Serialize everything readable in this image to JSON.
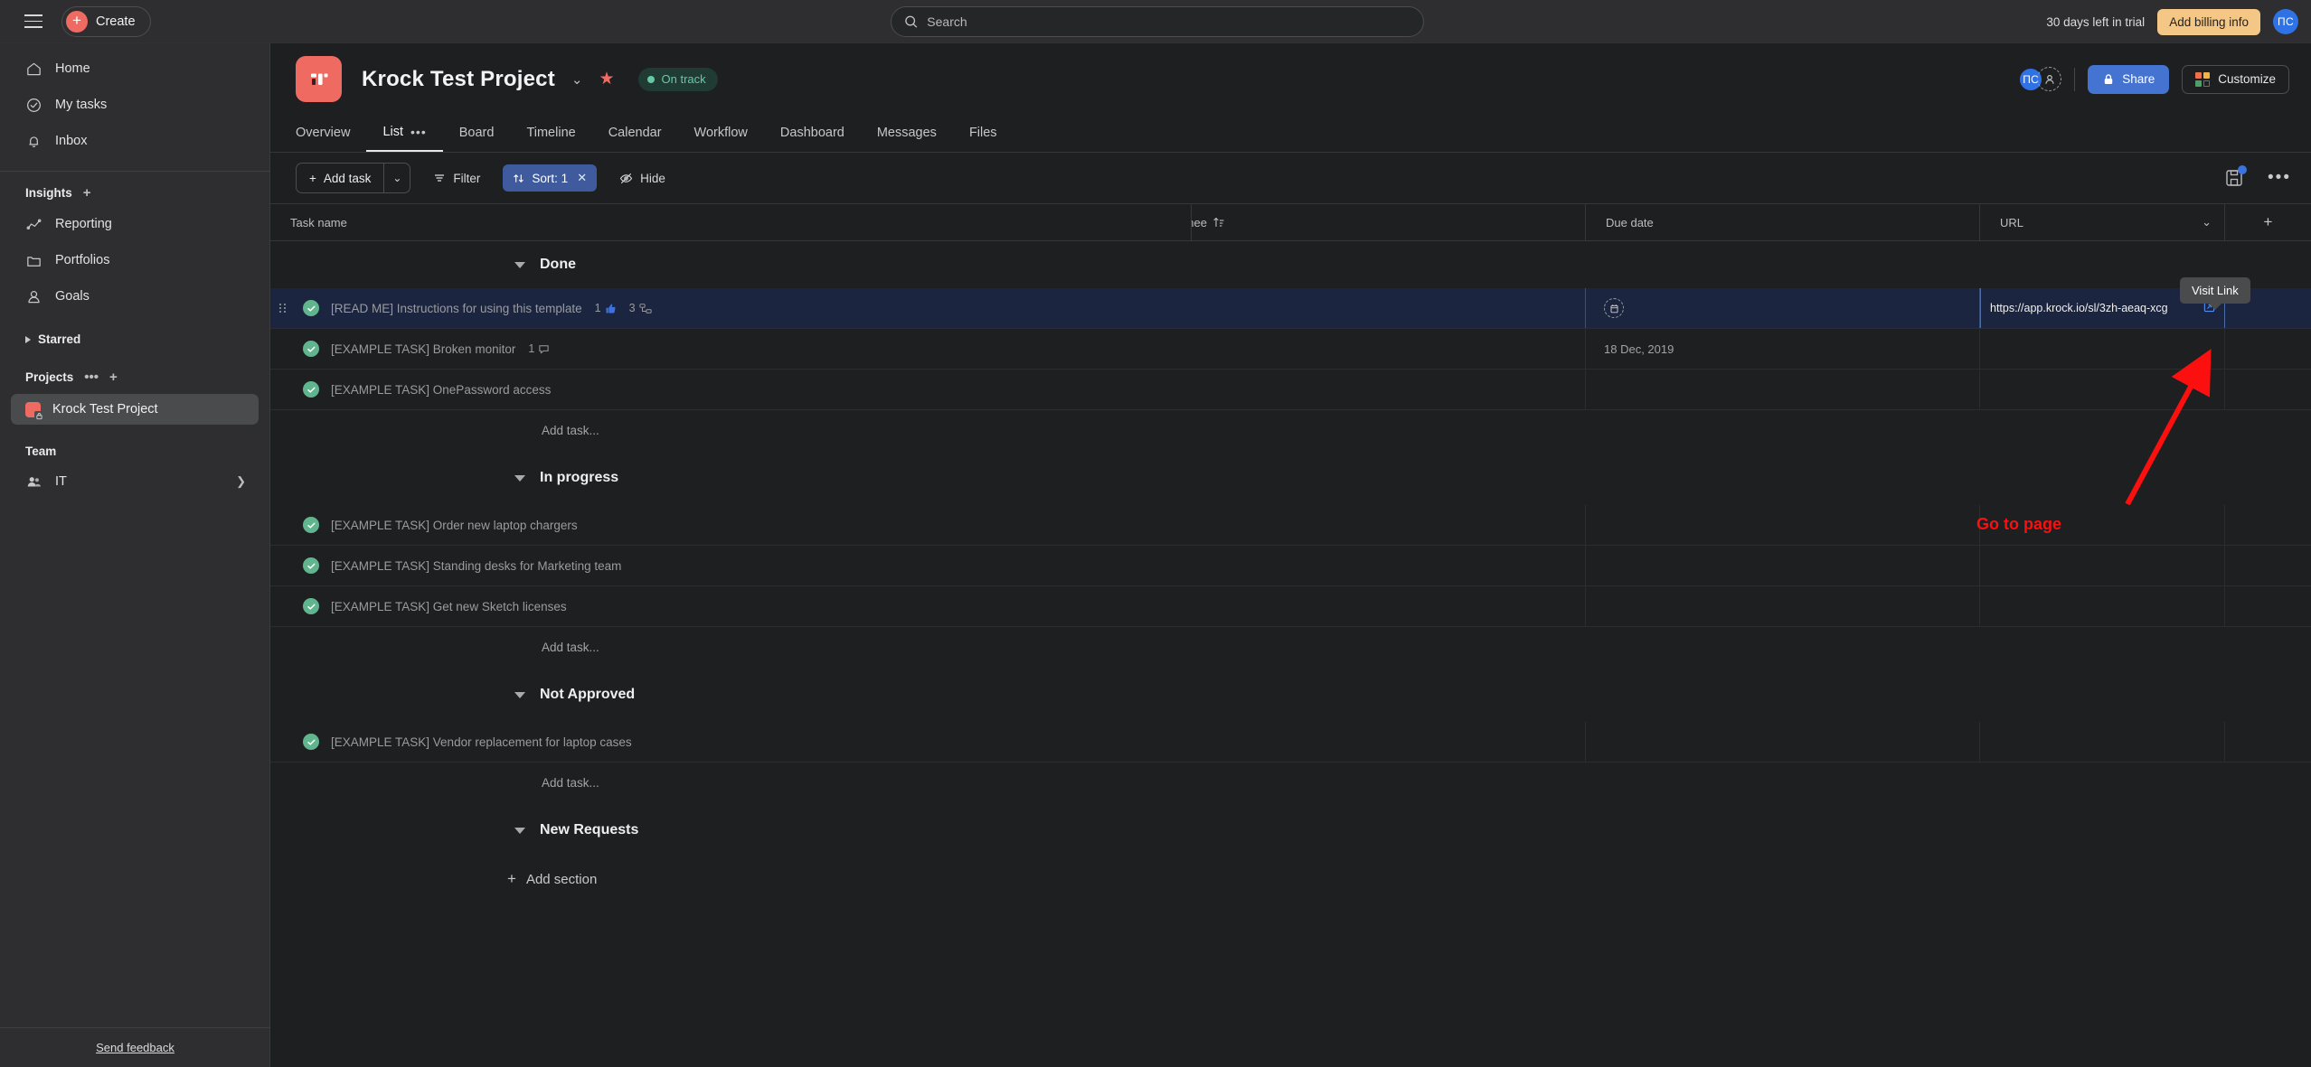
{
  "topbar": {
    "menu_icon": "hamburger-icon",
    "create_label": "Create",
    "search_placeholder": "Search",
    "trial_text": "30 days left in trial",
    "billing_label": "Add billing info",
    "avatar_initials": "ПС"
  },
  "sidebar": {
    "nav": [
      {
        "label": "Home",
        "icon": "home-icon"
      },
      {
        "label": "My tasks",
        "icon": "check-circle-icon"
      },
      {
        "label": "Inbox",
        "icon": "bell-icon"
      }
    ],
    "insights_label": "Insights",
    "insights": [
      {
        "label": "Reporting",
        "icon": "chart-line-icon"
      },
      {
        "label": "Portfolios",
        "icon": "folder-icon"
      },
      {
        "label": "Goals",
        "icon": "goal-icon"
      }
    ],
    "starred_label": "Starred",
    "projects_label": "Projects",
    "projects": [
      {
        "label": "Krock Test Project",
        "color": "#ef6b62"
      }
    ],
    "team_label": "Team",
    "teams": [
      {
        "label": "IT",
        "icon": "people-icon"
      }
    ],
    "feedback_label": "Send feedback"
  },
  "project": {
    "title": "Krock Test Project",
    "status": "On track",
    "status_color": "#67c9a3",
    "avatar_initials": "ПС",
    "share_label": "Share",
    "customize_label": "Customize",
    "tabs": [
      {
        "label": "Overview",
        "active": false
      },
      {
        "label": "List",
        "active": true
      },
      {
        "label": "Board",
        "active": false
      },
      {
        "label": "Timeline",
        "active": false
      },
      {
        "label": "Calendar",
        "active": false
      },
      {
        "label": "Workflow",
        "active": false
      },
      {
        "label": "Dashboard",
        "active": false
      },
      {
        "label": "Messages",
        "active": false
      },
      {
        "label": "Files",
        "active": false
      }
    ]
  },
  "toolbar": {
    "add_task_label": "Add task",
    "filter_label": "Filter",
    "sort_label": "Sort: 1",
    "sort_clear": "✕",
    "hide_label": "Hide",
    "save_icon": "save-icon",
    "more_icon": "more-horizontal-icon"
  },
  "table": {
    "columns": [
      {
        "key": "name",
        "label": "Task name"
      },
      {
        "key": "assignee",
        "label": "gnee"
      },
      {
        "key": "due",
        "label": "Due date"
      },
      {
        "key": "url",
        "label": "URL"
      }
    ],
    "add_column_label": "+",
    "add_task_label": "Add task...",
    "add_section_label": "Add section",
    "sections": [
      {
        "title": "Done",
        "tasks": [
          {
            "name": "[READ ME] Instructions for using this template",
            "likes": "1",
            "subtasks": "3",
            "comments": "",
            "due": "",
            "url": "https://app.krock.io/sl/3zh-aeaq-xcg",
            "selected": true,
            "due_icon": "calendar-icon"
          },
          {
            "name": "[EXAMPLE TASK] Broken monitor",
            "likes": "",
            "subtasks": "",
            "comments": "1",
            "due": "18 Dec, 2019",
            "url": "",
            "selected": false
          },
          {
            "name": "[EXAMPLE TASK] OnePassword access",
            "likes": "",
            "subtasks": "",
            "comments": "",
            "due": "",
            "url": "",
            "selected": false
          }
        ]
      },
      {
        "title": "In progress",
        "tasks": [
          {
            "name": "[EXAMPLE TASK] Order new laptop chargers",
            "likes": "",
            "subtasks": "",
            "comments": "",
            "due": "",
            "url": "",
            "selected": false
          },
          {
            "name": "[EXAMPLE TASK] Standing desks for Marketing team",
            "likes": "",
            "subtasks": "",
            "comments": "",
            "due": "",
            "url": "",
            "selected": false
          },
          {
            "name": "[EXAMPLE TASK] Get new Sketch licenses",
            "likes": "",
            "subtasks": "",
            "comments": "",
            "due": "",
            "url": "",
            "selected": false
          }
        ]
      },
      {
        "title": "Not Approved",
        "tasks": [
          {
            "name": "[EXAMPLE TASK] Vendor replacement for laptop cases",
            "likes": "",
            "subtasks": "",
            "comments": "",
            "due": "",
            "url": "",
            "selected": false
          }
        ]
      },
      {
        "title": "New Requests",
        "tasks": []
      }
    ]
  },
  "overlay": {
    "tooltip_text": "Visit Link",
    "annotation_text": "Go to page",
    "annotation_color": "#fb0f0f"
  }
}
